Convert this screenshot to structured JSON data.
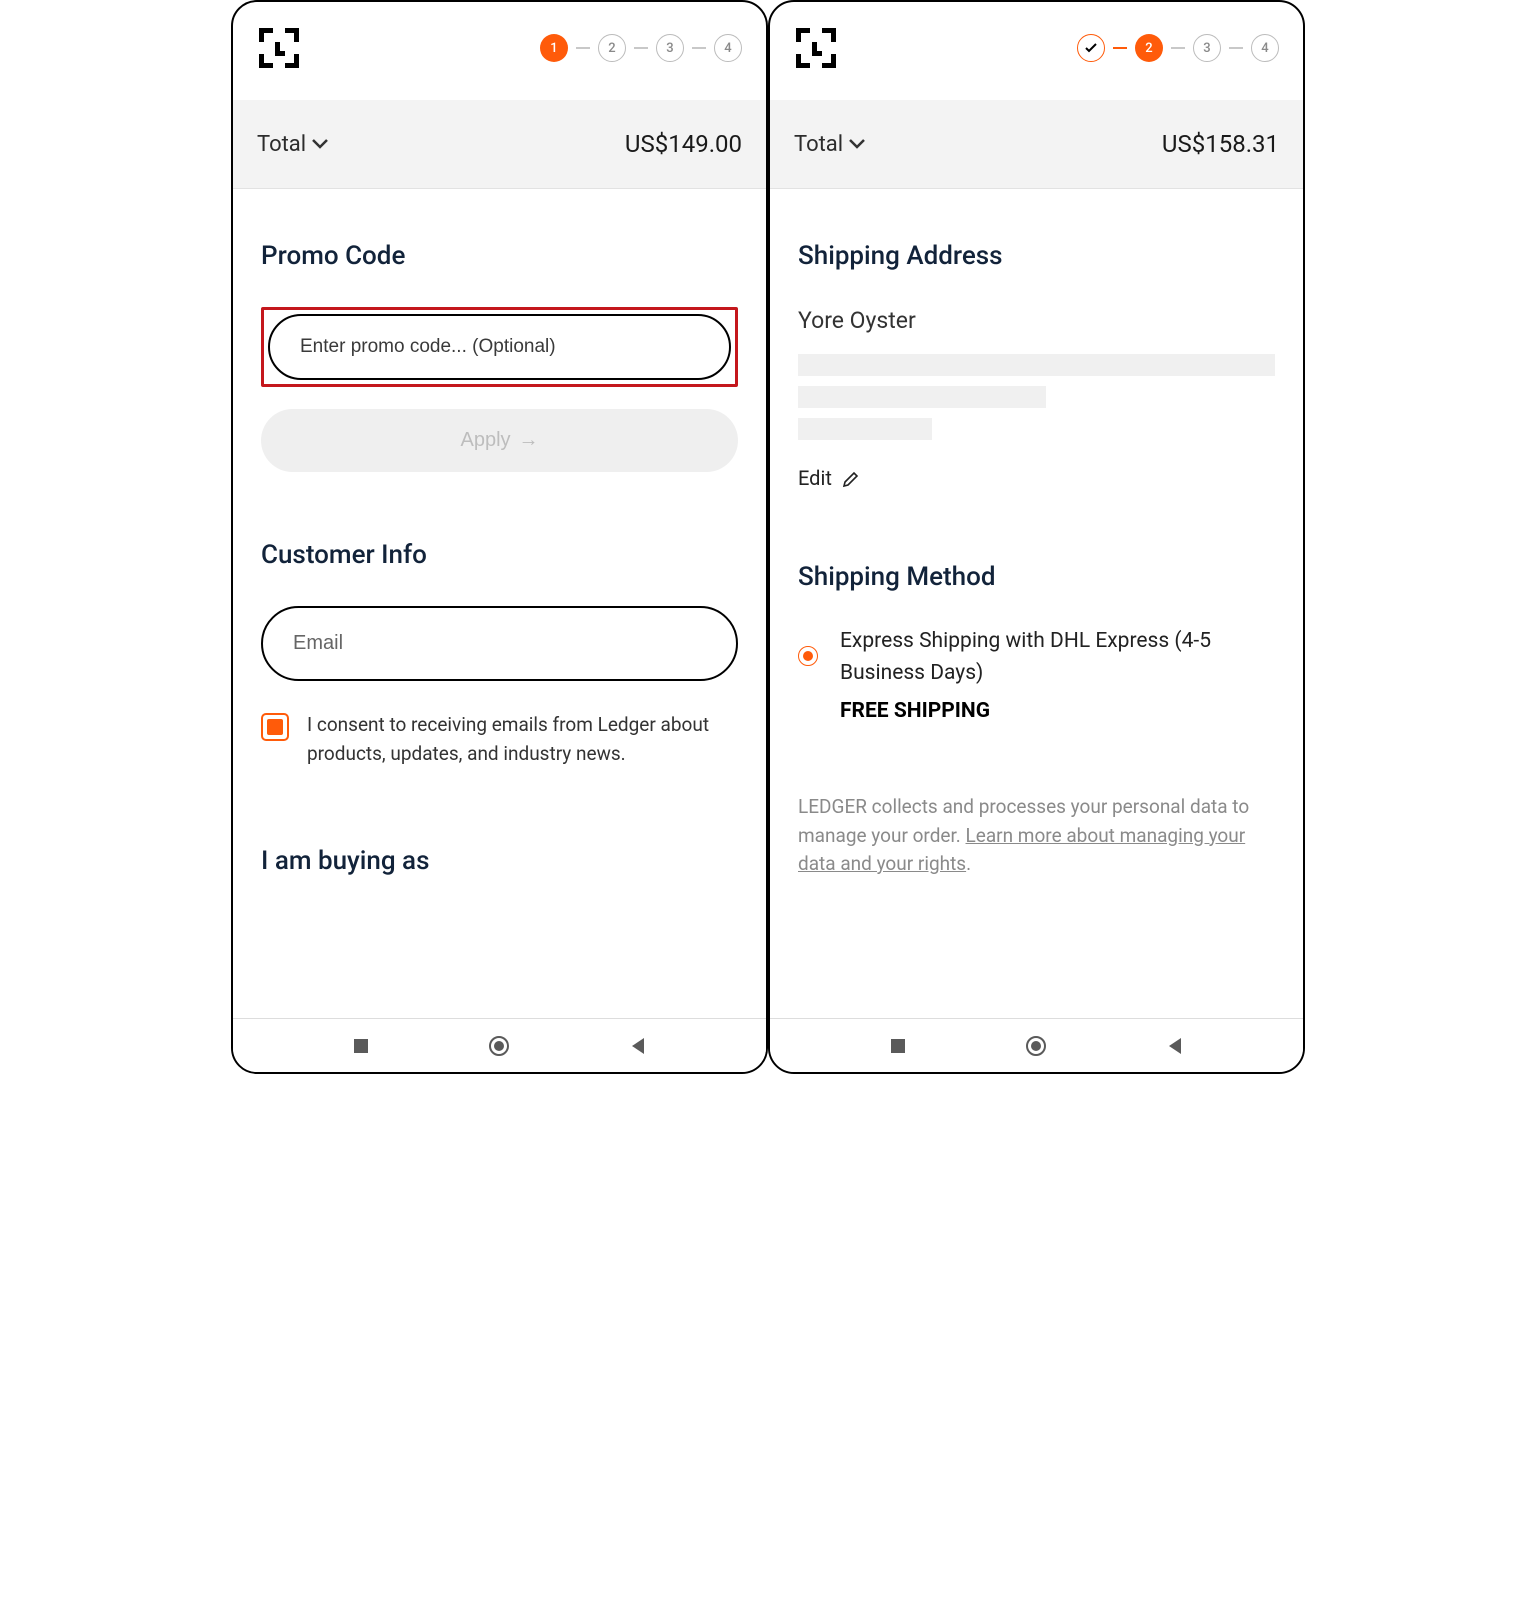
{
  "left": {
    "steps": [
      "1",
      "2",
      "3",
      "4"
    ],
    "active_step": 1,
    "total_label": "Total",
    "total_amount": "US$149.00",
    "promo_title": "Promo Code",
    "promo_placeholder": "Enter promo code... (Optional)",
    "apply_label": "Apply",
    "customer_title": "Customer Info",
    "email_placeholder": "Email",
    "consent_text": "I consent to receiving emails from Ledger about products, updates, and industry news.",
    "buying_title": "I am buying as"
  },
  "right": {
    "steps": [
      "✓",
      "2",
      "3",
      "4"
    ],
    "total_label": "Total",
    "total_amount": "US$158.31",
    "shipping_title": "Shipping Address",
    "name": "Yore Oyster",
    "edit_label": "Edit",
    "method_title": "Shipping Method",
    "method_desc": "Express Shipping with DHL Express (4-5 Business Days)",
    "free": "FREE SHIPPING",
    "legal_prefix": "LEDGER collects and processes your personal data to manage your order. ",
    "legal_link": "Learn more about managing your data and your rights"
  }
}
